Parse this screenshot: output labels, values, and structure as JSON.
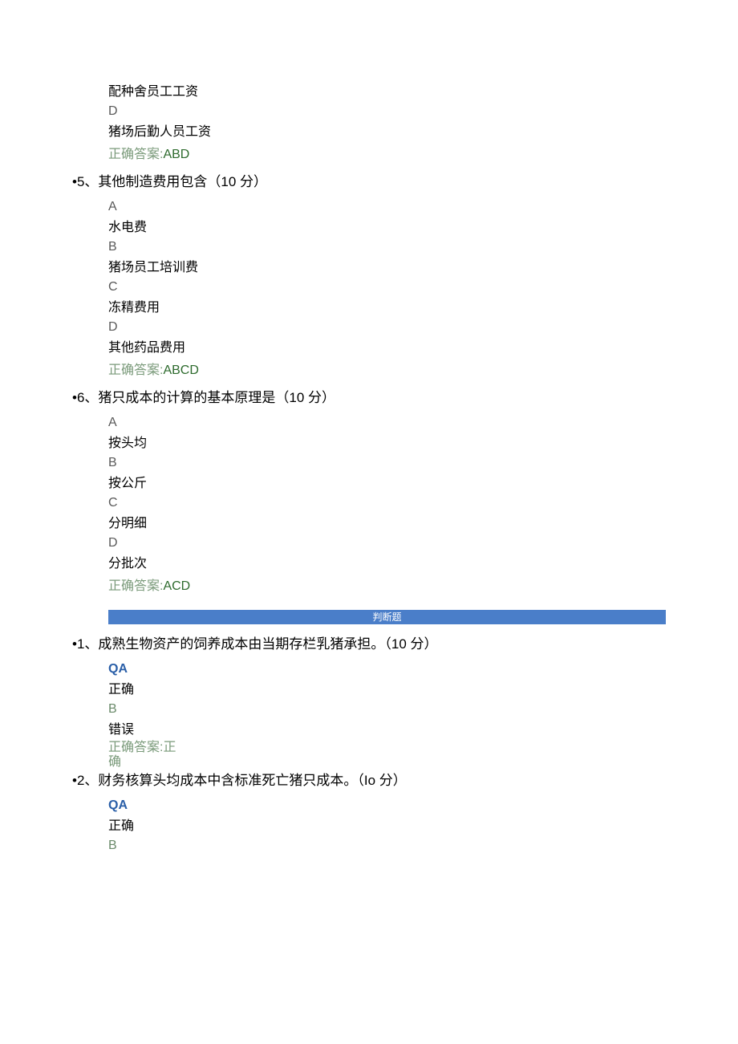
{
  "pre": {
    "optC": "配种舍员工工资",
    "letterD": "D",
    "optD": "猪场后勤人员工资",
    "ansLabel": "正确答案:",
    "ansVal": "ABD"
  },
  "q5": {
    "title": "•5、其他制造费用包含（10 分）",
    "A": "A",
    "Atext": "水电费",
    "B": "B",
    "Btext": "猪场员工培训费",
    "C": "C",
    "Ctext": "冻精费用",
    "D": "D",
    "Dtext": "其他药品费用",
    "ansLabel": "正确答案:",
    "ansVal": "ABCD"
  },
  "q6": {
    "title": "•6、猪只成本的计算的基本原理是（10 分）",
    "A": "A",
    "Atext": "按头均",
    "B": "B",
    "Btext": "按公斤",
    "C": "C",
    "Ctext": "分明细",
    "D": "D",
    "Dtext": "分批次",
    "ansLabel": "正确答案:",
    "ansVal": "ACD"
  },
  "section2": "判断题",
  "tf1": {
    "title": "•1、成熟生物资产的饲养成本由当期存栏乳猪承担。（10 分）",
    "QA": "QA",
    "Atext": "正确",
    "B": "B",
    "Btext": "错误",
    "ansLabel": "正确答案:",
    "ansVal1": "正",
    "ansVal2": "确"
  },
  "tf2": {
    "title": "•2、财务核算头均成本中含标准死亡猪只成本。（Io 分）",
    "QA": "QA",
    "Atext": "正确",
    "B": "B"
  }
}
